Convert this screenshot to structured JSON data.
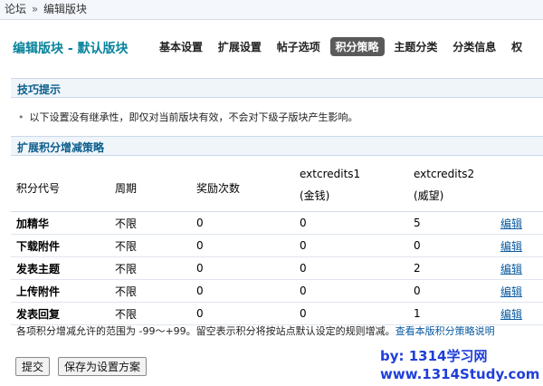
{
  "breadcrumb": {
    "home": "论坛",
    "sep": "»",
    "current": "编辑版块"
  },
  "page": {
    "title": "编辑版块 - 默认版块"
  },
  "tabs": [
    "基本设置",
    "扩展设置",
    "帖子选项",
    "积分策略",
    "主题分类",
    "分类信息",
    "权"
  ],
  "active_tab": "积分策略",
  "tips": {
    "heading": "技巧提示",
    "text": "以下设置没有继承性，即仅对当前版块有效，不会对下级子版块产生影响。"
  },
  "policy": {
    "heading": "扩展积分增减策略",
    "columns": {
      "code": "积分代号",
      "period": "周期",
      "reward": "奖励次数",
      "credit1": "extcredits1",
      "credit1_sub": "(金钱)",
      "credit2": "extcredits2",
      "credit2_sub": "(威望)"
    },
    "rows": [
      {
        "name": "加精华",
        "period": "不限",
        "reward": "0",
        "c1": "0",
        "c2": "5",
        "edit": "编辑"
      },
      {
        "name": "下载附件",
        "period": "不限",
        "reward": "0",
        "c1": "0",
        "c2": "0",
        "edit": "编辑"
      },
      {
        "name": "发表主题",
        "period": "不限",
        "reward": "0",
        "c1": "0",
        "c2": "2",
        "edit": "编辑"
      },
      {
        "name": "上传附件",
        "period": "不限",
        "reward": "0",
        "c1": "0",
        "c2": "0",
        "edit": "编辑"
      },
      {
        "name": "发表回复",
        "period": "不限",
        "reward": "0",
        "c1": "0",
        "c2": "1",
        "edit": "编辑"
      }
    ],
    "note": "各项积分增减允许的范围为 -99～+99。留空表示积分将按站点默认设定的规则增减。",
    "note_link": "查看本版积分策略说明"
  },
  "buttons": {
    "submit": "提交",
    "save_scheme": "保存为设置方案"
  },
  "watermark": {
    "line1": "by: 1314学习网",
    "line2": "www.1314Study.com"
  }
}
